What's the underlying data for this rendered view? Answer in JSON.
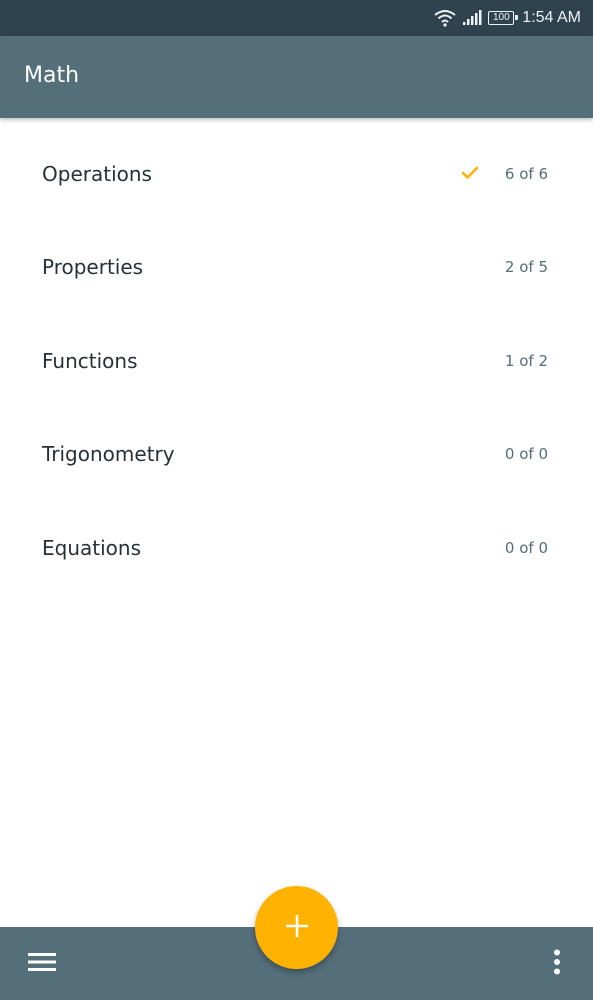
{
  "status_bar": {
    "time": "1:54 AM",
    "battery": "100",
    "icons": [
      "wifi-icon",
      "signal-icon",
      "battery-icon"
    ]
  },
  "app_bar": {
    "title": "Math"
  },
  "topics": [
    {
      "label": "Operations",
      "count": "6 of 6",
      "completed": true
    },
    {
      "label": "Properties",
      "count": "2 of 5",
      "completed": false
    },
    {
      "label": "Functions",
      "count": "1 of 2",
      "completed": false
    },
    {
      "label": "Trigonometry",
      "count": "0 of 0",
      "completed": false
    },
    {
      "label": "Equations",
      "count": "0 of 0",
      "completed": false
    }
  ],
  "bottom_bar": {
    "icons": [
      "menu-icon",
      "add-icon",
      "more-vert-icon"
    ]
  },
  "colors": {
    "status_bar": "#2f434f",
    "app_bar": "#546e7a",
    "accent": "#ffb300",
    "text_primary": "#263238",
    "text_secondary": "#546e7a"
  }
}
